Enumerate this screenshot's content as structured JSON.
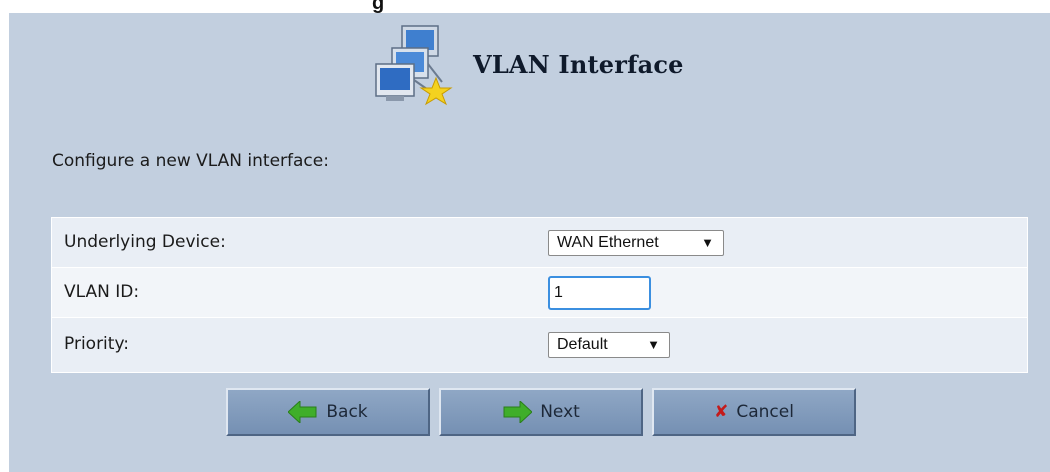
{
  "page": {
    "title": "VLAN Interface",
    "intro": "Configure a new VLAN interface:",
    "top_fragment": "g"
  },
  "form": {
    "underlying_device": {
      "label": "Underlying Device:",
      "value": "WAN Ethernet"
    },
    "vlan_id": {
      "label": "VLAN ID:",
      "value": "1"
    },
    "priority": {
      "label": "Priority:",
      "value": "Default"
    }
  },
  "buttons": {
    "back": "Back",
    "next": "Next",
    "cancel": "Cancel"
  },
  "icons": {
    "header": "network-computers-star-icon",
    "back": "back-arrow-icon",
    "next": "next-arrow-icon",
    "cancel": "cancel-x-icon",
    "dropdown": "dropdown-arrow"
  },
  "colors": {
    "panel": "#c2cfdf",
    "form_bg": "#e9eef5",
    "button": "#7f99bb",
    "arrow_green": "#3fae2a",
    "cancel_red": "#c41a1a"
  }
}
